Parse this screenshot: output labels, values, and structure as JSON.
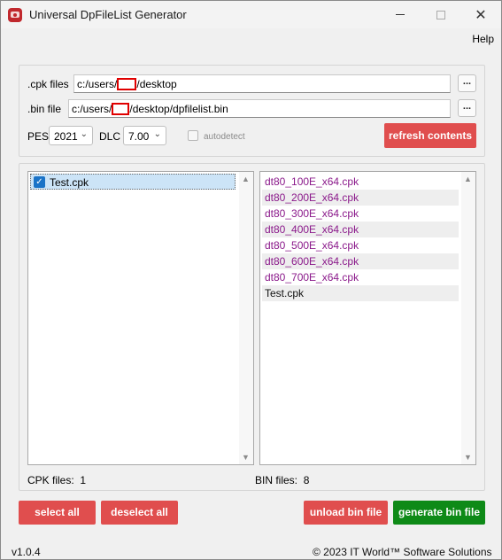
{
  "window": {
    "title": "Universal DpFileList Generator"
  },
  "menu": {
    "help": "Help"
  },
  "cpk": {
    "label": ".cpk files",
    "path_prefix": "c:/users/",
    "path_suffix": "/desktop",
    "browse": "..."
  },
  "bin": {
    "label": ".bin file",
    "path_prefix": "c:/users/",
    "path_suffix": "/desktop/dpfilelist.bin",
    "browse": "..."
  },
  "pes": {
    "label": "PES",
    "value": "2021"
  },
  "dlc": {
    "label": "DLC",
    "value": "7.00"
  },
  "autodetect": {
    "label": "autodetect",
    "checked": false
  },
  "buttons": {
    "refresh": "refresh contents",
    "select_all": "select all",
    "deselect_all": "deselect all",
    "unload_bin": "unload bin file",
    "generate_bin": "generate bin file"
  },
  "cpk_list": {
    "items": [
      {
        "name": "Test.cpk",
        "checked": true
      }
    ],
    "count_label": "CPK files:",
    "count": "1"
  },
  "bin_list": {
    "items": [
      {
        "name": "dt80_100E_x64.cpk"
      },
      {
        "name": "dt80_200E_x64.cpk"
      },
      {
        "name": "dt80_300E_x64.cpk"
      },
      {
        "name": "dt80_400E_x64.cpk"
      },
      {
        "name": "dt80_500E_x64.cpk"
      },
      {
        "name": "dt80_600E_x64.cpk"
      },
      {
        "name": "dt80_700E_x64.cpk"
      },
      {
        "name": "Test.cpk"
      }
    ],
    "count_label": "BIN files:",
    "count": "8"
  },
  "footer": {
    "version": "v1.0.4",
    "copyright": "© 2023 IT World™ Software Solutions"
  },
  "colors": {
    "red_button": "#e04e4e",
    "green_button": "#0e8a17",
    "bin_item_text": "#8b1a8b",
    "selection": "#cce4f7"
  }
}
